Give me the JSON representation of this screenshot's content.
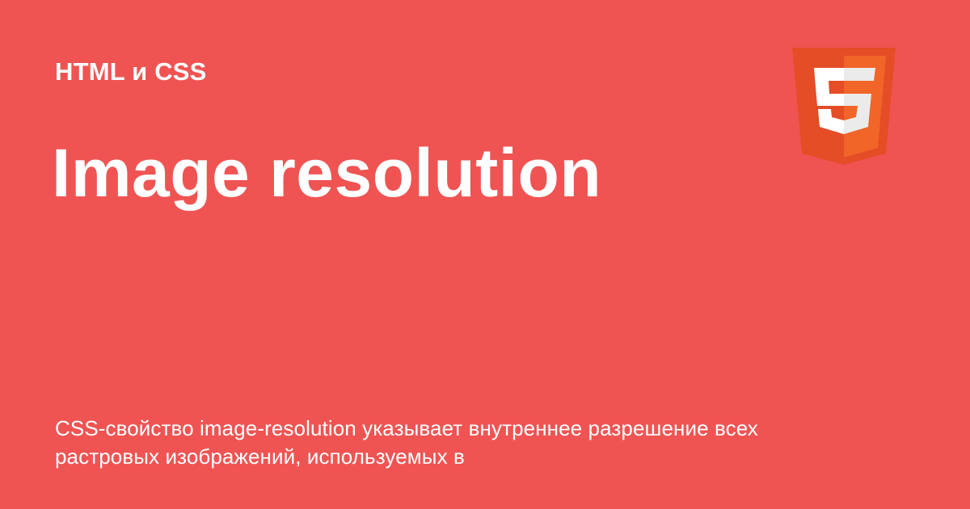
{
  "card": {
    "category": "HTML и CSS",
    "title": "Image resolution",
    "description": "CSS-свойство image-resolution указывает внутреннее разрешение всех растровых изображений, используемых в",
    "logo_icon": "html5-logo-icon"
  },
  "colors": {
    "background": "#ef5453",
    "text": "#ffffff",
    "logo_shield_dark": "#e44d26",
    "logo_shield_light": "#f16529"
  }
}
